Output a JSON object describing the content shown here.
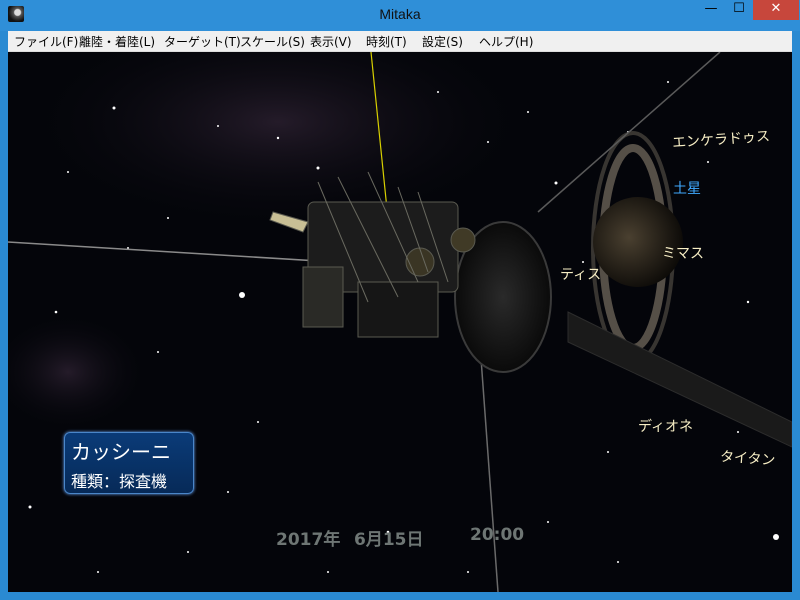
{
  "window": {
    "title": "Mitaka",
    "minimize_glyph": "—",
    "maximize_glyph": "☐",
    "close_glyph": "✕"
  },
  "menu": [
    {
      "label": "ファイル(F)"
    },
    {
      "label": "離陸・着陸(L)"
    },
    {
      "label": "ターゲット(T)"
    },
    {
      "label": "スケール(S)"
    },
    {
      "label": "表示(V)"
    },
    {
      "label": "時刻(T)"
    },
    {
      "label": "設定(S)"
    },
    {
      "label": "ヘルプ(H)"
    }
  ],
  "labels": {
    "enceladus": "エンケラドゥス",
    "saturn": "土星",
    "mimas": "ミマス",
    "tethys": "ティス",
    "dione": "ディオネ",
    "titan": "タイタン"
  },
  "info": {
    "name": "カッシーニ",
    "type": "種類：探査機"
  },
  "datetime": {
    "year": "2017年",
    "date": "6月15日",
    "time": "20:00"
  },
  "colors": {
    "label": "#f7eec5",
    "planet_label": "#3fa9ff",
    "info_bg": "#0a3b78",
    "datetime": "#6e7674",
    "orbit_line": "#d8d000"
  }
}
